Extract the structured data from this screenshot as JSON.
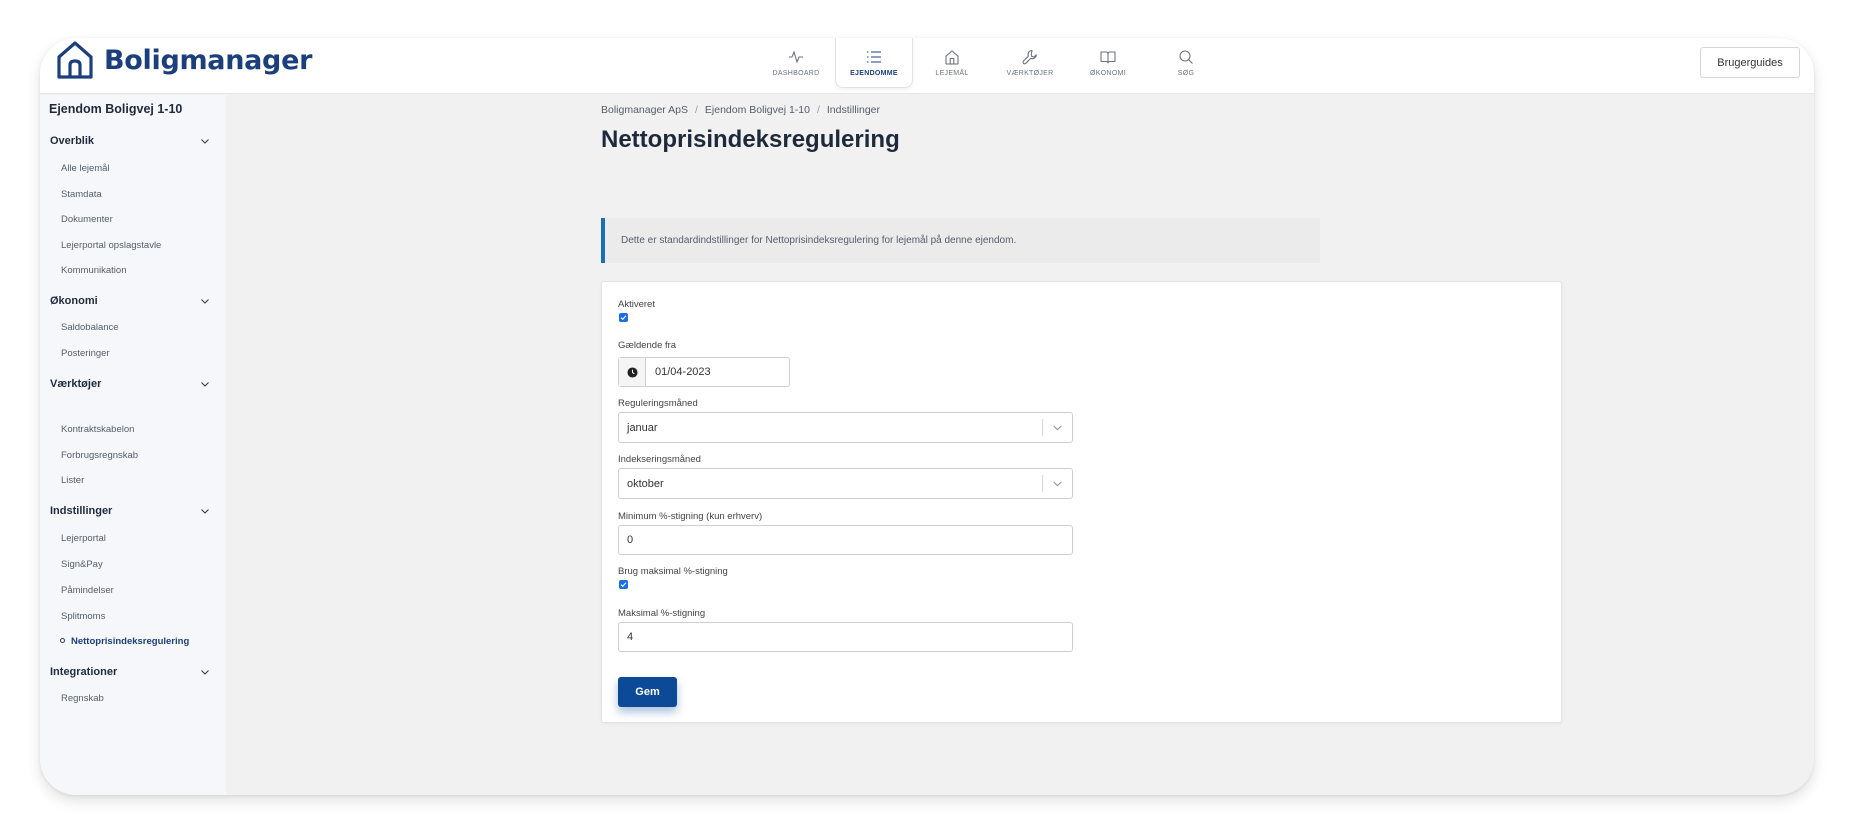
{
  "app": {
    "name": "Boligmanager"
  },
  "nav": {
    "items": [
      {
        "label": "DASHBOARD",
        "icon": "activity-icon",
        "active": false
      },
      {
        "label": "EJENDOMME",
        "icon": "list-icon",
        "active": true
      },
      {
        "label": "LEJEMÅL",
        "icon": "home-icon",
        "active": false
      },
      {
        "label": "VÆRKTØJER",
        "icon": "wrench-icon",
        "active": false
      },
      {
        "label": "ØKONOMI",
        "icon": "book-icon",
        "active": false
      },
      {
        "label": "SØG",
        "icon": "search-icon",
        "active": false
      }
    ],
    "guide_button": "Brugerguides"
  },
  "sidebar": {
    "title": "Ejendom Boligvej 1-10",
    "groups": [
      {
        "label": "Overblik",
        "items": [
          "Alle lejemål",
          "Stamdata",
          "Dokumenter",
          "Lejerportal opslagstavle",
          "Kommunikation"
        ]
      },
      {
        "label": "Økonomi",
        "items": [
          "Saldobalance",
          "Posteringer"
        ]
      },
      {
        "label": "Værktøjer",
        "items": [
          "Kontraktskabelon",
          "Forbrugsregnskab",
          "Lister"
        ]
      },
      {
        "label": "Indstillinger",
        "items": [
          "Lejerportal",
          "Sign&Pay",
          "Påmindelser",
          "Splitmoms",
          "Nettoprisindeksregulering"
        ]
      },
      {
        "label": "Integrationer",
        "items": [
          "Regnskab"
        ]
      }
    ],
    "active_item": "Nettoprisindeksregulering"
  },
  "breadcrumb": [
    "Boligmanager ApS",
    "Ejendom Boligvej 1-10",
    "Indstillinger"
  ],
  "page_title": "Nettoprisindeksregulering",
  "info": "Dette er standardindstillinger for Nettoprisindeksregulering for lejemål på denne ejendom.",
  "form": {
    "activated_label": "Aktiveret",
    "activated": true,
    "valid_from_label": "Gældende fra",
    "valid_from": "01/04-2023",
    "regulation_month_label": "Reguleringsmåned",
    "regulation_month": "januar",
    "index_month_label": "Indekseringsmåned",
    "index_month": "oktober",
    "min_increase_label": "Minimum %-stigning (kun erhverv)",
    "min_increase": "0",
    "use_max_label": "Brug maksimal %-stigning",
    "use_max": true,
    "max_increase_label": "Maksimal %-stigning",
    "max_increase": "4",
    "save_label": "Gem"
  },
  "colors": {
    "brand": "#1b3f7c",
    "button": "#0c4a97",
    "info_accent": "#1a6fb5",
    "checkbox": "#1a6fe5"
  }
}
